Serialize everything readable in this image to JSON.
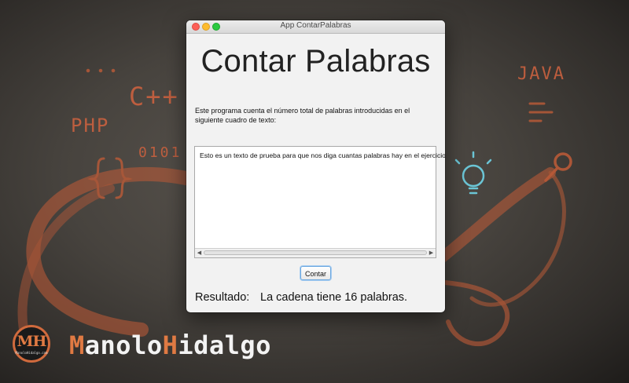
{
  "background": {
    "doodles": {
      "php": "PHP",
      "cpp": "C++",
      "java": "JAVA",
      "binary": "0101"
    },
    "brand": {
      "logo_initials": "MH",
      "logo_subtext": "ManoloHidalgo.com",
      "first_initial": "M",
      "first_rest": "anolo",
      "last_initial": "H",
      "last_rest": "idalgo"
    },
    "colors": {
      "accent": "#e07a43",
      "doodle": "#c8613f"
    }
  },
  "window": {
    "title": "App ContarPalabras",
    "controls": [
      "close",
      "minimize",
      "maximize"
    ],
    "heading": "Contar Palabras",
    "description": "Este programa cuenta el número total de palabras introducidas en el siguiente cuadro de texto:",
    "textarea": {
      "value": "Esto es un texto de prueba para que nos diga cuantas palabras hay en el ejercicio"
    },
    "button_label": "Contar",
    "result_label": "Resultado:",
    "result_value": "La cadena tiene 16 palabras."
  }
}
